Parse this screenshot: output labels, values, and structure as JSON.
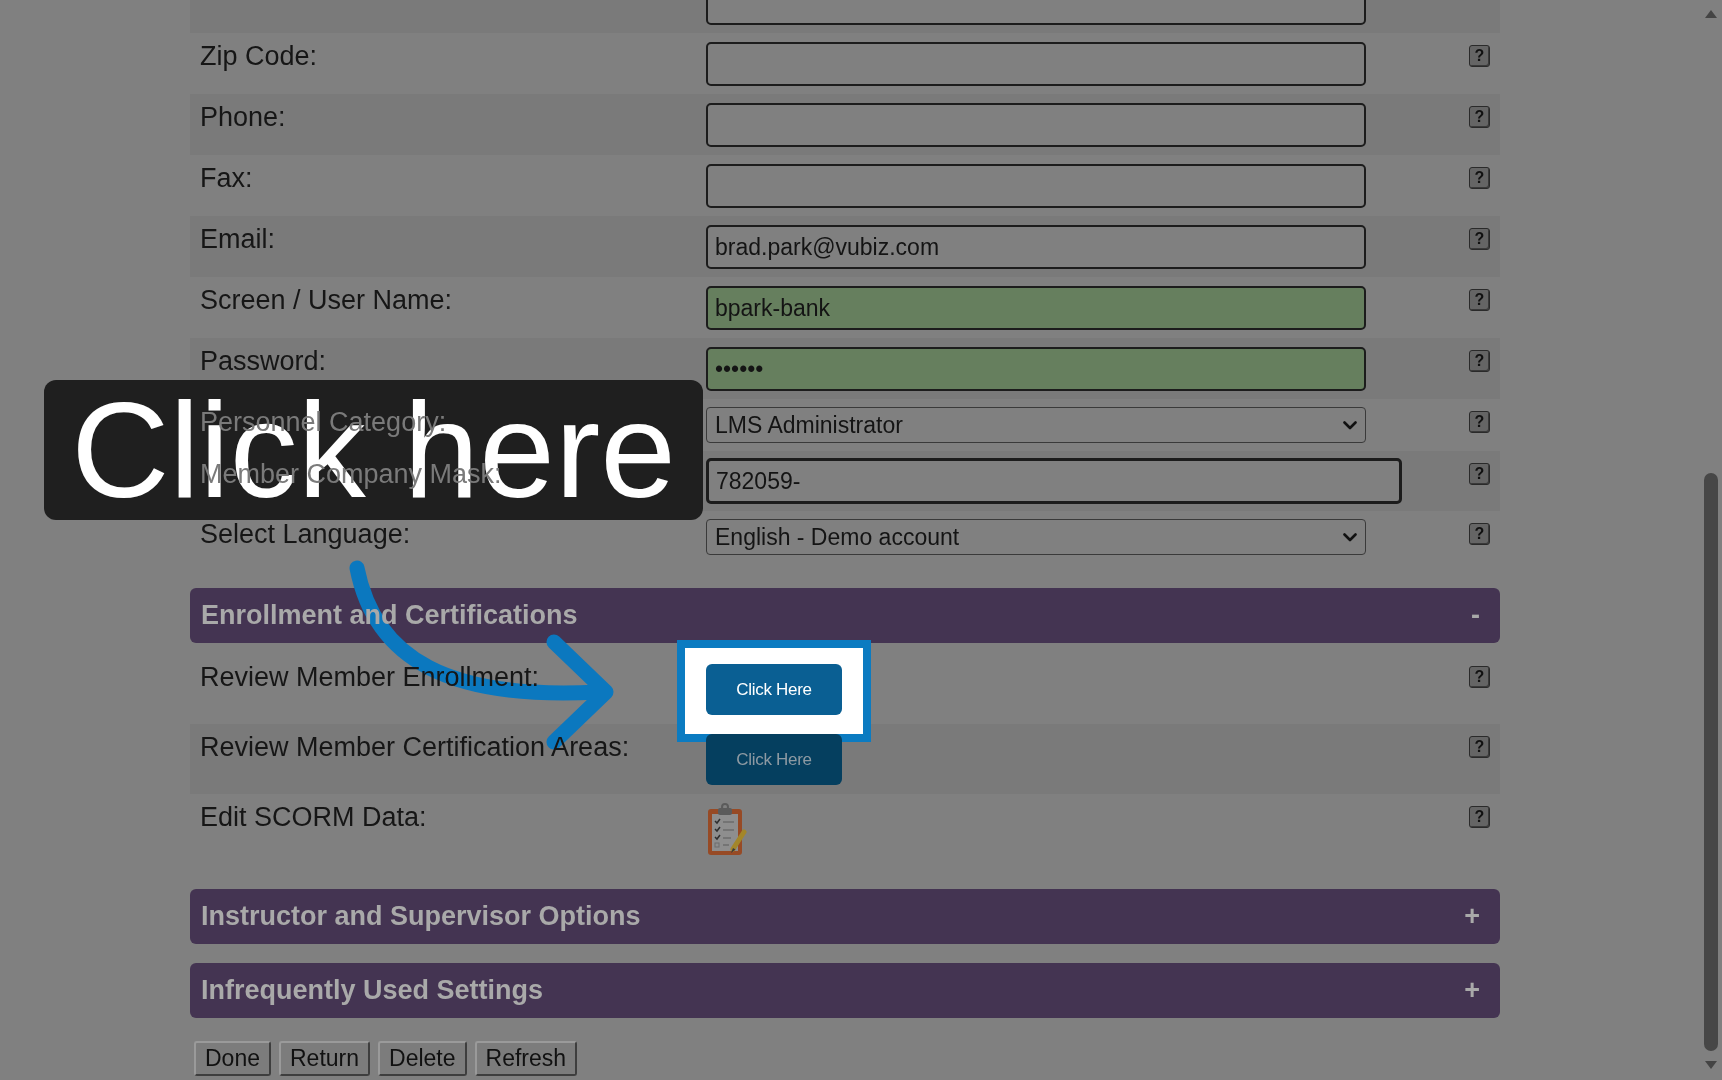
{
  "fields": [
    {
      "kind": "text",
      "highlighted": false
    },
    {
      "label": "Zip Code:",
      "kind": "text",
      "highlighted": false,
      "help": "?"
    },
    {
      "label": "Phone:",
      "kind": "text",
      "highlighted": false,
      "help": "?"
    },
    {
      "label": "Fax:",
      "kind": "text",
      "highlighted": false,
      "help": "?"
    },
    {
      "label": "Email:",
      "kind": "text",
      "value": "brad.park@vubiz.com",
      "highlighted": false,
      "help": "?"
    },
    {
      "label": "Screen / User Name:",
      "kind": "text",
      "value": "bpark-bank",
      "highlighted": true,
      "help": "?"
    },
    {
      "label": "Password:",
      "kind": "text",
      "value": "••••••",
      "highlighted": true,
      "help": "?"
    },
    {
      "label": "Personnel Category:",
      "kind": "select",
      "value": "LMS Administrator",
      "highlighted": false,
      "help": "?"
    },
    {
      "label": "Member Company Mask:",
      "kind": "code",
      "value": "782059-",
      "highlighted": false,
      "help": "?"
    },
    {
      "label": "Select Language:",
      "kind": "select",
      "value": "English - Demo account",
      "highlighted": false,
      "help": "?"
    }
  ],
  "sections": [
    {
      "title": "Enrollment and Certifications",
      "toggle": "-",
      "rows": [
        {
          "label": "Review Member Enrollment:",
          "kind": "button",
          "button": "Click Here",
          "highlighted": true,
          "help": "?"
        },
        {
          "label": "Review Member Certification Areas:",
          "kind": "button",
          "button": "Click Here",
          "highlighted": false,
          "help": "?"
        },
        {
          "label": "Edit SCORM Data:",
          "kind": "icon",
          "help": "?"
        }
      ]
    },
    {
      "title": "Instructor and Supervisor Options",
      "toggle": "+"
    },
    {
      "title": "Infrequently Used Settings",
      "toggle": "+"
    }
  ],
  "actions": [
    "Done",
    "Return",
    "Delete",
    "Refresh"
  ],
  "callout": {
    "text": "Click here"
  }
}
